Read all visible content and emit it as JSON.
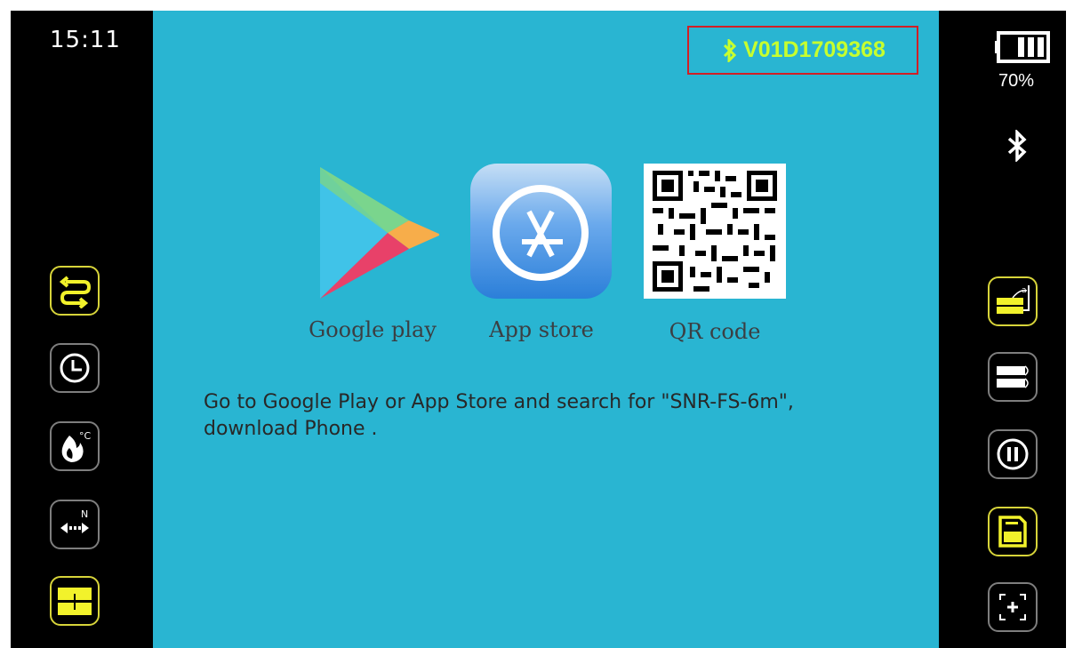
{
  "status": {
    "time": "15:11",
    "battery_percent": "70%",
    "battery_level": 0.7,
    "serial": "V01D1709368"
  },
  "apps": [
    {
      "label": "Google play",
      "icon": "google-play-icon"
    },
    {
      "label": "App store",
      "icon": "app-store-icon"
    },
    {
      "label": "QR code",
      "icon": "qr-code-icon"
    }
  ],
  "instructions": {
    "line1": "Go to Google Play or App Store and search for \"SNR-FS-6m\",",
    "line2": "download Phone ."
  },
  "left_buttons": [
    {
      "icon": "loop-arrows-icon"
    },
    {
      "icon": "timer-icon"
    },
    {
      "icon": "flame-celsius-icon"
    },
    {
      "icon": "distance-n-icon"
    },
    {
      "icon": "split-view-icon"
    }
  ],
  "right_buttons": [
    {
      "icon": "level-measure-icon"
    },
    {
      "icon": "stack-icon"
    },
    {
      "icon": "pause-icon"
    },
    {
      "icon": "save-icon"
    },
    {
      "icon": "crosshair-icon"
    }
  ],
  "colors": {
    "main_bg": "#29b5d2",
    "accent_yellow": "#f2f22b",
    "serial_green": "#c7ff2e",
    "highlight_red": "#d11f25"
  }
}
